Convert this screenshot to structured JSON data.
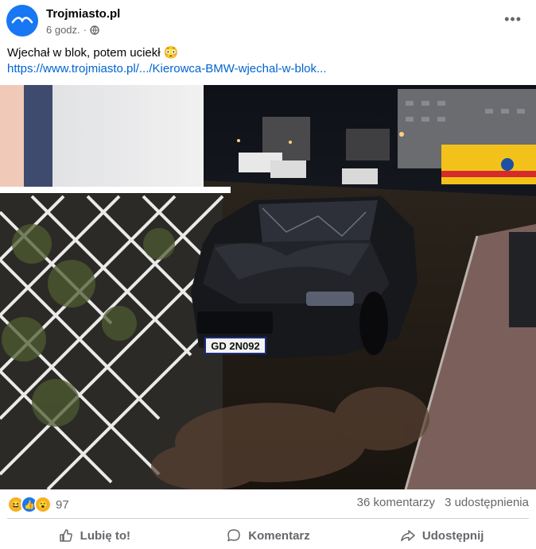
{
  "post": {
    "author": "Trojmiasto.pl",
    "time": "6 godz.",
    "text": "Wjechał w blok, potem uciekł 😳",
    "link": "https://www.trojmiasto.pl/.../Kierowca-BMW-wjechal-w-blok...",
    "image_plate": "GD 2N092"
  },
  "stats": {
    "reactions_count": "97",
    "comments": "36 komentarzy",
    "shares": "3 udostępnienia"
  },
  "actions": {
    "like": "Lubię to!",
    "comment": "Komentarz",
    "share": "Udostępnij"
  },
  "colors": {
    "brand": "#1877f2",
    "link": "#0064d1",
    "meta": "#65676b"
  }
}
